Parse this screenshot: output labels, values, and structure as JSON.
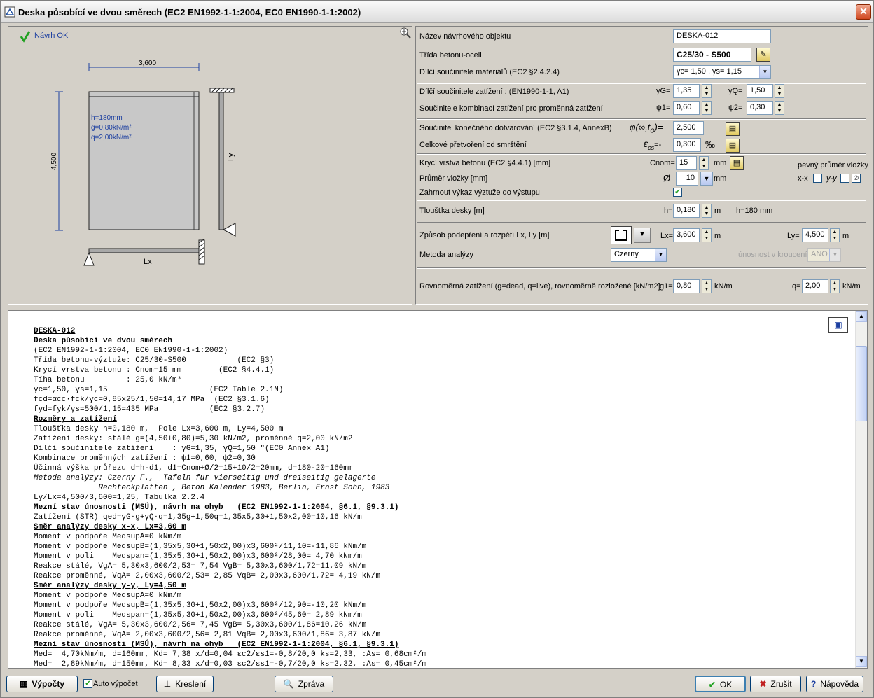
{
  "window": {
    "title": "Deska působící ve dvou směrech (EC2 EN1992-1-1:2004, EC0 EN1990-1-1:2002)",
    "close_label": "✕"
  },
  "drawing": {
    "status": "Návrh OK",
    "dim_width": "3,600",
    "dim_height": "4,500",
    "info_lines": [
      "h=180mm",
      "g=0,80kN/m²",
      "q=2,00kN/m²"
    ],
    "label_lx": "Lx",
    "label_ly": "Ly"
  },
  "props": {
    "name_label": "Název návrhového objektu",
    "name_value": "DESKA-012",
    "class_label": "Třída betonu-oceli",
    "class_value": "C25/30 - S500",
    "matfactor_label": "Dílčí součinitele materiálů (EC2 §2.4.2.4)",
    "matfactor_value": "γc= 1,50 , γs= 1,15",
    "loadfactor_label": "Dílčí součinitele zatížení    : (EN1990-1-1, A1)",
    "gammaG_label": "γG=",
    "gammaG_value": "1,35",
    "gammaQ_label": "γQ=",
    "gammaQ_value": "1,50",
    "combo_label": "Součinitele kombinací zatížení pro proměnná zatížení",
    "psi1_label": "ψ1=",
    "psi1_value": "0,60",
    "psi2_label": "ψ2=",
    "psi2_value": "0,30",
    "creep_label": "Součinitel konečného dotvarování (EC2 §3.1.4, AnnexB)",
    "creep_sym": "φ(∞,t",
    "creep_sub": "O",
    "creep_eq": ")=",
    "creep_value": "2,500",
    "shrink_label": "Celkové přetvoření od smrštění",
    "shrink_sym": "ε",
    "shrink_sub": "cs",
    "shrink_eq": "=-",
    "shrink_value": "0,300",
    "shrink_unit": "‰",
    "cover_label": "Krycí vrstva betonu (EC2 §4.4.1) [mm]",
    "cover_sym": "Cnom=",
    "cover_value": "15",
    "cover_unit": "mm",
    "fixed_diam_label": "pevný průměr vložky",
    "bar_label": "Průměr vložky [mm]",
    "bar_sym": "Ø",
    "bar_value": "10",
    "bar_unit": "mm",
    "xx_label": "x-x",
    "yy_label": "y-y",
    "include_label": "Zahrnout výkaz výztuže do výstupu",
    "thick_label": "Tloušťka desky [m]",
    "thick_sym": "h=",
    "thick_value": "0,180",
    "thick_unit": "m",
    "thick_info": "h=180 mm",
    "support_label": "Způsob podepření a rozpětí Lx, Ly [m]",
    "lx_label": "Lx=",
    "lx_value": "3,600",
    "lx_unit": "m",
    "ly_label": "Ly=",
    "ly_value": "4,500",
    "ly_unit": "m",
    "method_label": "Metoda analýzy",
    "method_value": "Czerny",
    "torsion_label": "únosnost v kroucení",
    "torsion_value": "ANO",
    "uniform_label": "Rovnoměrná zatížení (g=dead, q=live), rovnoměrně rozložené [kN/m2]",
    "g1_label": "g1=",
    "g1_value": "0,80",
    "g1_unit": "kN/m",
    "q_label": "q=",
    "q_value": "2,00",
    "q_unit": "kN/m"
  },
  "report": {
    "lines": [
      {
        "t": "DESKA-012",
        "s": "b"
      },
      {
        "t": "Deska působící ve dvou směrech",
        "s": "bo"
      },
      {
        "t": "(EC2 EN1992-1-1:2004, EC0 EN1990-1-1:2002)",
        "s": ""
      },
      {
        "t": "Třída betonu-výztuže: C25/30-S500           (EC2 §3)",
        "s": ""
      },
      {
        "t": "Krycí vrstva betonu : Cnom=15 mm        (EC2 §4.4.1)",
        "s": ""
      },
      {
        "t": "Tíha betonu         : 25,0 kN/m³",
        "s": ""
      },
      {
        "t": "γc=1,50, γs=1,15                      (EC2 Table 2.1N)",
        "s": ""
      },
      {
        "t": "fcd=αcc·fck/γc=0,85x25/1,50=14,17 MPa  (EC2 §3.1.6)",
        "s": ""
      },
      {
        "t": "fyd=fyk/γs=500/1,15=435 MPa           (EC2 §3.2.7)",
        "s": ""
      },
      {
        "t": "Rozměry a zatížení",
        "s": "b"
      },
      {
        "t": "Tloušťka desky h=0,180 m,  Pole Lx=3,600 m, Ly=4,500 m",
        "s": ""
      },
      {
        "t": "Zatížení desky: stálé g=(4,50+0,80)=5,30 kN/m2, proměnné q=2,00 kN/m2",
        "s": ""
      },
      {
        "t": "Dílčí součinitele zatížení    : γG=1,35, γQ=1,50 \"(EC0 Annex A1)",
        "s": ""
      },
      {
        "t": "Kombinace proměnných zatížení : ψ1=0,60, ψ2=0,30",
        "s": ""
      },
      {
        "t": "Účinná výška průřezu d=h-d1, d1=Cnom+Ø/2=15+10/2=20mm, d=180-20=160mm",
        "s": ""
      },
      {
        "t": "Metoda analýzy: Czerny F.,  Tafeln fur vierseitig und dreiseitig gelagerte",
        "s": "i"
      },
      {
        "t": "              Rechteckplatten , Beton Kalender 1983, Berlin, Ernst Sohn, 1983",
        "s": "i"
      },
      {
        "t": "Ly/Lx=4,500/3,600=1,25, Tabulka 2.2.4",
        "s": ""
      },
      {
        "t": "Mezní stav únosnosti (MSÚ), návrh na ohyb   (EC2 EN1992-1-1:2004, §6.1, §9.3.1)",
        "s": "b"
      },
      {
        "t": "Zatížení (STR) qed=γG·g+γQ·q=1,35g+1,50q=1,35x5,30+1,50x2,00=10,16 kN/m",
        "s": ""
      },
      {
        "t": "Směr analýzy desky x-x, Lx=3,60 m",
        "s": "b"
      },
      {
        "t": "Moment v podpoře MedsupA=0 kNm/m",
        "s": ""
      },
      {
        "t": "Moment v podpoře MedsupB=(1,35x5,30+1,50x2,00)x3,600²/11,10=-11,86 kNm/m",
        "s": ""
      },
      {
        "t": "Moment v poli    Medspan=(1,35x5,30+1,50x2,00)x3,600²/28,00= 4,70 kNm/m",
        "s": ""
      },
      {
        "t": "Reakce stálé, VgA= 5,30x3,600/2,53= 7,54 VgB= 5,30x3,600/1,72=11,09 kN/m",
        "s": ""
      },
      {
        "t": "Reakce proměnné, VqA= 2,00x3,600/2,53= 2,85 VqB= 2,00x3,600/1,72= 4,19 kN/m",
        "s": ""
      },
      {
        "t": "Směr analýzy desky y-y, Ly=4,50 m",
        "s": "b"
      },
      {
        "t": "Moment v podpoře MedsupA=0 kNm/m",
        "s": ""
      },
      {
        "t": "Moment v podpoře MedsupB=(1,35x5,30+1,50x2,00)x3,600²/12,90=-10,20 kNm/m",
        "s": ""
      },
      {
        "t": "Moment v poli    Medspan=(1,35x5,30+1,50x2,00)x3,600²/45,60= 2,89 kNm/m",
        "s": ""
      },
      {
        "t": "Reakce stálé, VgA= 5,30x3,600/2,56= 7,45 VgB= 5,30x3,600/1,86=10,26 kN/m",
        "s": ""
      },
      {
        "t": "Reakce proměnné, VqA= 2,00x3,600/2,56= 2,81 VqB= 2,00x3,600/1,86= 3,87 kN/m",
        "s": ""
      },
      {
        "t": "Mezní stav únosnosti (MSÚ), návrh na ohyb   (EC2 EN1992-1-1:2004, §6.1, §9.3.1)",
        "s": "b"
      },
      {
        "t": "Med=  4,70kNm/m, d=160mm, Kd= 7,38 x/d=0,04 εc2/εs1=-0,8/20,0 ks=2,33, :As= 0,68cm²/m",
        "s": ""
      },
      {
        "t": "Med=  2,89kNm/m, d=150mm, Kd= 8,33 x/d=0,03 εc2/εs1=-0,7/20,0 ks=2,32, :As= 0,45cm²/m",
        "s": ""
      }
    ]
  },
  "footer": {
    "calc_label": "Výpočty",
    "auto_label": "Auto výpočet",
    "draw_label": "Kreslení",
    "report_label": "Zpráva",
    "ok_label": "OK",
    "cancel_label": "Zrušit",
    "help_label": "Nápověda"
  }
}
